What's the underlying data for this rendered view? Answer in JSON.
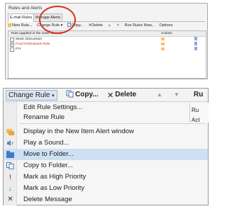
{
  "dialog": {
    "title": "Rules and Alerts",
    "tabs": [
      "E-mail Rules",
      "Manage Alerts"
    ],
    "toolbar": [
      "New Rule...",
      "Change Rule",
      "Copy...",
      "Delete",
      "Run Rules Now...",
      "Options"
    ],
    "list": {
      "col_rule": "Rule (applied in the order shown)",
      "col_actions": "Actions",
      "rows": [
        {
          "name": "Music Discussion",
          "checked": false,
          "color": "#222222"
        },
        {
          "name": "Food Enthusiasts Rule",
          "checked": true,
          "color": "#d0251a"
        },
        {
          "name": "FYI",
          "checked": false,
          "color": "#222222"
        }
      ]
    }
  },
  "menu": {
    "toolbar": {
      "change_rule": "Change Rule",
      "copy": "Copy...",
      "delete": "Delete",
      "run": "Ru"
    },
    "items": [
      {
        "label": "Edit Rule Settings...",
        "icon": "none"
      },
      {
        "label": "Rename Rule",
        "icon": "none"
      },
      {
        "label": "Display in the New Item Alert window",
        "icon": "alert-window-icon"
      },
      {
        "label": "Play a Sound...",
        "icon": "speaker-icon"
      },
      {
        "label": "Move to Folder...",
        "icon": "move-folder-icon"
      },
      {
        "label": "Copy to Folder...",
        "icon": "copy-folder-icon"
      },
      {
        "label": "Mark as High Priority",
        "icon": "high-priority-icon"
      },
      {
        "label": "Mark as Low Priority",
        "icon": "low-priority-icon"
      },
      {
        "label": "Delete Message",
        "icon": "delete-x-icon"
      }
    ],
    "right_cells": [
      "Ru",
      "Act"
    ]
  },
  "colors": {
    "accent_blue": "#2a6fbd",
    "highlight_red": "#d9301f",
    "priority_red": "#d0251a"
  }
}
